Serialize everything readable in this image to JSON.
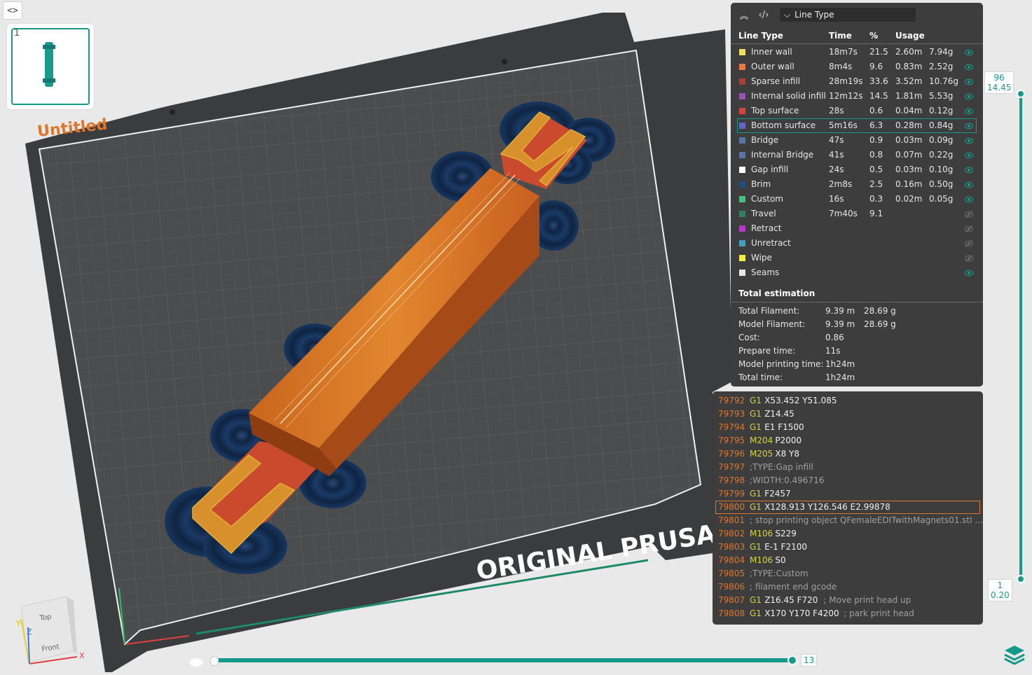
{
  "toolbar": {
    "collapse_icon": "code-brackets-icon"
  },
  "plate": {
    "number": "1",
    "name": "Untitled"
  },
  "bed": {
    "brand": "ORIGINAL PRUSA"
  },
  "view_cube": {
    "top": "Top",
    "front": "Front",
    "x": "X",
    "y": "Y",
    "z": "Z"
  },
  "legend": {
    "view_type": "Line Type",
    "headers": {
      "type": "Line Type",
      "time": "Time",
      "pct": "%",
      "usage": "Usage"
    },
    "rows": [
      {
        "name": "Inner wall",
        "time": "18m7s",
        "pct": "21.5",
        "len": "2.60m",
        "wt": "7.94g",
        "color": "#f2e14a",
        "visible": true
      },
      {
        "name": "Outer wall",
        "time": "8m4s",
        "pct": "9.6",
        "len": "0.83m",
        "wt": "2.52g",
        "color": "#f2763a",
        "visible": true
      },
      {
        "name": "Sparse infill",
        "time": "28m19s",
        "pct": "33.6",
        "len": "3.52m",
        "wt": "10.76g",
        "color": "#b33b32",
        "visible": true
      },
      {
        "name": "Internal solid infill",
        "time": "12m12s",
        "pct": "14.5",
        "len": "1.81m",
        "wt": "5.53g",
        "color": "#9a4ec2",
        "visible": true
      },
      {
        "name": "Top surface",
        "time": "28s",
        "pct": "0.6",
        "len": "0.04m",
        "wt": "0.12g",
        "color": "#e0403c",
        "visible": true
      },
      {
        "name": "Bottom surface",
        "time": "5m16s",
        "pct": "6.3",
        "len": "0.28m",
        "wt": "0.84g",
        "color": "#6262d4",
        "visible": true
      },
      {
        "name": "Bridge",
        "time": "47s",
        "pct": "0.9",
        "len": "0.03m",
        "wt": "0.09g",
        "color": "#5675a8",
        "visible": true
      },
      {
        "name": "Internal Bridge",
        "time": "41s",
        "pct": "0.8",
        "len": "0.07m",
        "wt": "0.22g",
        "color": "#5675a8",
        "visible": true
      },
      {
        "name": "Gap infill",
        "time": "24s",
        "pct": "0.5",
        "len": "0.03m",
        "wt": "0.10g",
        "color": "#ffffff",
        "visible": true
      },
      {
        "name": "Brim",
        "time": "2m8s",
        "pct": "2.5",
        "len": "0.16m",
        "wt": "0.50g",
        "color": "#1a4f8a",
        "visible": true
      },
      {
        "name": "Custom",
        "time": "16s",
        "pct": "0.3",
        "len": "0.02m",
        "wt": "0.05g",
        "color": "#3fc47f",
        "visible": true
      },
      {
        "name": "Travel",
        "time": "7m40s",
        "pct": "9.1",
        "len": "",
        "wt": "",
        "color": "#2f7f6a",
        "visible": false
      },
      {
        "name": "Retract",
        "time": "",
        "pct": "",
        "len": "",
        "wt": "",
        "color": "#c033d0",
        "visible": false
      },
      {
        "name": "Unretract",
        "time": "",
        "pct": "",
        "len": "",
        "wt": "",
        "color": "#3aa2c8",
        "visible": false
      },
      {
        "name": "Wipe",
        "time": "",
        "pct": "",
        "len": "",
        "wt": "",
        "color": "#f6f032",
        "visible": false
      },
      {
        "name": "Seams",
        "time": "",
        "pct": "",
        "len": "",
        "wt": "",
        "color": "#e6e6e6",
        "visible": true
      }
    ],
    "selected_row": "Bottom surface",
    "total_title": "Total estimation",
    "totals": [
      {
        "key": "Total Filament:",
        "v1": "9.39 m",
        "v2": "28.69 g"
      },
      {
        "key": "Model Filament:",
        "v1": "9.39 m",
        "v2": "28.69 g"
      },
      {
        "key": "Cost:",
        "v1": "0.86",
        "v2": ""
      },
      {
        "key": "Prepare time:",
        "v1": "11s",
        "v2": ""
      },
      {
        "key": "Model printing time:",
        "v1": "1h24m",
        "v2": ""
      },
      {
        "key": "Total time:",
        "v1": "1h24m",
        "v2": ""
      }
    ]
  },
  "gcode": {
    "lines": [
      {
        "n": "79792",
        "cmd": "G1",
        "args": "X53.452 Y51.085",
        "comment": ""
      },
      {
        "n": "79793",
        "cmd": "G1",
        "args": "Z14.45",
        "comment": ""
      },
      {
        "n": "79794",
        "cmd": "G1",
        "args": "E1 F1500",
        "comment": ""
      },
      {
        "n": "79795",
        "cmd": "M204",
        "args": "P2000",
        "comment": ""
      },
      {
        "n": "79796",
        "cmd": "M205",
        "args": "X8 Y8",
        "comment": ""
      },
      {
        "n": "79797",
        "cmd": "",
        "args": "",
        "comment": ";TYPE:Gap infill"
      },
      {
        "n": "79798",
        "cmd": "",
        "args": "",
        "comment": ";WIDTH:0.496716"
      },
      {
        "n": "79799",
        "cmd": "G1",
        "args": "F2457",
        "comment": ""
      },
      {
        "n": "79800",
        "cmd": "G1",
        "args": "X128.913 Y126.546 E2.99878",
        "comment": ""
      },
      {
        "n": "79801",
        "cmd": "",
        "args": "",
        "comment": "; stop printing object QFemaleEDITwithMagnets01.stl ..."
      },
      {
        "n": "79802",
        "cmd": "M106",
        "args": "S229",
        "comment": ""
      },
      {
        "n": "79803",
        "cmd": "G1",
        "args": "E-1 F2100",
        "comment": ""
      },
      {
        "n": "79804",
        "cmd": "M106",
        "args": "S0",
        "comment": ""
      },
      {
        "n": "79805",
        "cmd": "",
        "args": "",
        "comment": ";TYPE:Custom"
      },
      {
        "n": "79806",
        "cmd": "",
        "args": "",
        "comment": "; filament end gcode"
      },
      {
        "n": "79807",
        "cmd": "G1",
        "args": "Z16.45 F720",
        "comment": "; Move print head up"
      },
      {
        "n": "79808",
        "cmd": "G1",
        "args": "X170 Y170 F4200",
        "comment": "; park print head"
      }
    ],
    "selected": "79800"
  },
  "layer_slider": {
    "top_layer": "96",
    "top_height": "14.45",
    "bottom_layer": "1",
    "bottom_height": "0.20"
  },
  "move_slider": {
    "value": "13"
  }
}
